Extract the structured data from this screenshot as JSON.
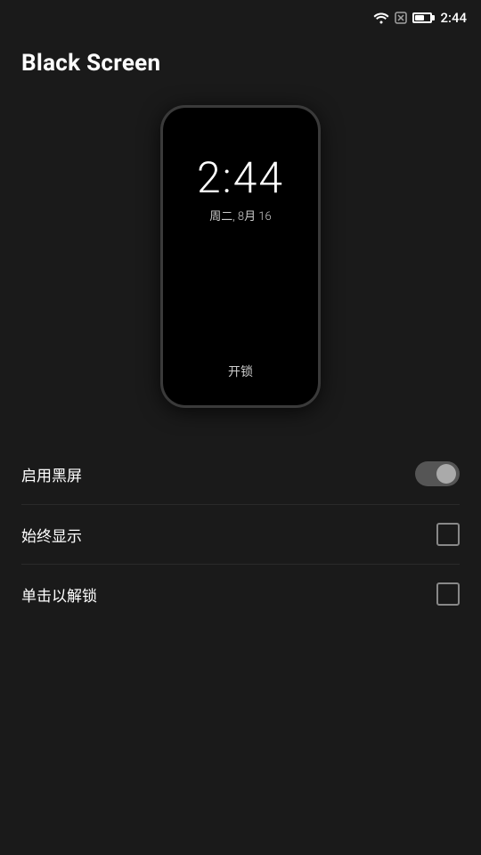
{
  "statusBar": {
    "time": "2:44",
    "wifiIcon": "wifi",
    "noSimIcon": "no-sim",
    "batteryIcon": "battery",
    "batteryPercent": 60
  },
  "appTitle": "Black Screen",
  "phoneMockup": {
    "time": "2:44",
    "date": "周二, 8月 16",
    "unlockLabel": "开锁"
  },
  "settings": [
    {
      "id": "enable-black-screen",
      "label": "启用黑屏",
      "controlType": "toggle",
      "enabled": false
    },
    {
      "id": "always-show",
      "label": "始终显示",
      "controlType": "checkbox",
      "checked": false
    },
    {
      "id": "tap-to-unlock",
      "label": "单击以解锁",
      "controlType": "checkbox",
      "checked": false
    }
  ]
}
